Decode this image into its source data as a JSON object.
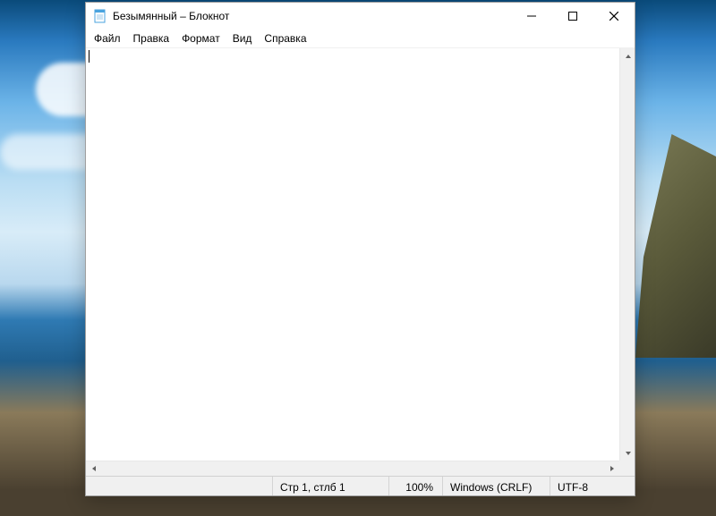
{
  "window": {
    "title": "Безымянный – Блокнот"
  },
  "menu": {
    "file": "Файл",
    "edit": "Правка",
    "format": "Формат",
    "view": "Вид",
    "help": "Справка"
  },
  "editor": {
    "content": ""
  },
  "status": {
    "position": "Стр 1, стлб 1",
    "zoom": "100%",
    "eol": "Windows (CRLF)",
    "encoding": "UTF-8"
  }
}
